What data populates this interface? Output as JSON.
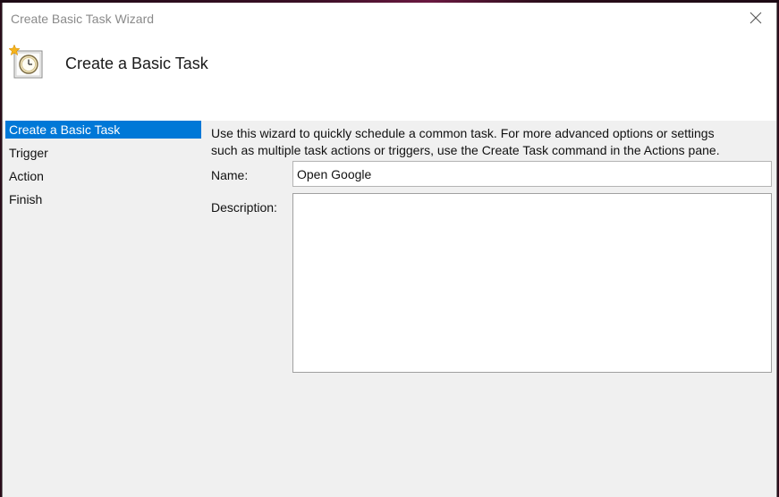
{
  "window": {
    "title": "Create Basic Task Wizard"
  },
  "header": {
    "title": "Create a Basic Task",
    "icon": "task-clock-icon"
  },
  "steps": [
    {
      "label": "Create a Basic Task",
      "active": true
    },
    {
      "label": "Trigger",
      "active": false
    },
    {
      "label": "Action",
      "active": false
    },
    {
      "label": "Finish",
      "active": false
    }
  ],
  "main": {
    "intro_line1": "Use this wizard to quickly schedule a common task.  For more advanced options or settings",
    "intro_line2": "such as multiple task actions or triggers, use the Create Task command in the Actions pane.",
    "name_label": "Name:",
    "name_value": "Open Google",
    "description_label": "Description:",
    "description_value": ""
  },
  "colors": {
    "accent": "#0078d7",
    "window_bg": "#f0f0f0",
    "title_text": "#8a8a8a"
  }
}
